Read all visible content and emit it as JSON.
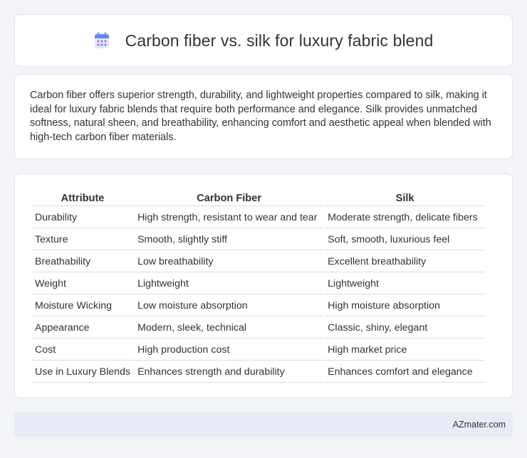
{
  "header": {
    "icon": "calendar-icon",
    "title": "Carbon fiber vs. silk for luxury fabric blend"
  },
  "summary": {
    "text": "Carbon fiber offers superior strength, durability, and lightweight properties compared to silk, making it ideal for luxury fabric blends that require both performance and elegance. Silk provides unmatched softness, natural sheen, and breathability, enhancing comfort and aesthetic appeal when blended with high-tech carbon fiber materials."
  },
  "table": {
    "headers": [
      "Attribute",
      "Carbon Fiber",
      "Silk"
    ],
    "rows": [
      [
        "Durability",
        "High strength, resistant to wear and tear",
        "Moderate strength, delicate fibers"
      ],
      [
        "Texture",
        "Smooth, slightly stiff",
        "Soft, smooth, luxurious feel"
      ],
      [
        "Breathability",
        "Low breathability",
        "Excellent breathability"
      ],
      [
        "Weight",
        "Lightweight",
        "Lightweight"
      ],
      [
        "Moisture Wicking",
        "Low moisture absorption",
        "High moisture absorption"
      ],
      [
        "Appearance",
        "Modern, sleek, technical",
        "Classic, shiny, elegant"
      ],
      [
        "Cost",
        "High production cost",
        "High market price"
      ],
      [
        "Use in Luxury Blends",
        "Enhances strength and durability",
        "Enhances comfort and elegance"
      ]
    ]
  },
  "footer": {
    "text": "AZmater.com"
  },
  "colors": {
    "page_background": "#f3f4f8",
    "card_background": "#ffffff",
    "footer_background": "#e6ebf5",
    "icon_blue": "#5b8def",
    "icon_purple": "#8f86e8"
  }
}
